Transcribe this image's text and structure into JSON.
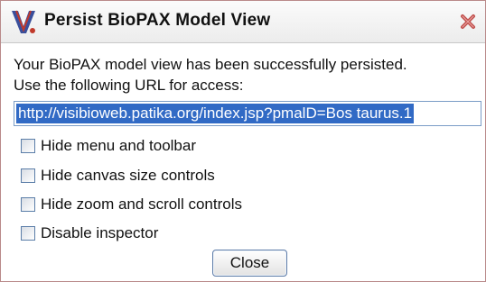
{
  "dialog": {
    "title": "Persist BioPAX Model View",
    "logo_icon": "visibioweb-v-logo-icon",
    "close_icon": "close-x-icon",
    "message_line1": "Your BioPAX model view has been successfully persisted.",
    "message_line2": "Use the following URL for access:",
    "url_value": "http://visibioweb.patika.org/index.jsp?pmalD=Bos taurus.1",
    "options": [
      {
        "label": "Hide menu and toolbar",
        "checked": false
      },
      {
        "label": "Hide canvas size controls",
        "checked": false
      },
      {
        "label": "Hide zoom and scroll controls",
        "checked": false
      },
      {
        "label": "Disable inspector",
        "checked": false
      }
    ],
    "close_button_label": "Close"
  },
  "colors": {
    "accent_selection": "#316ac5",
    "close_icon": "#c0504d",
    "logo_primary": "#3a4f9c",
    "logo_accent": "#c0392b"
  }
}
